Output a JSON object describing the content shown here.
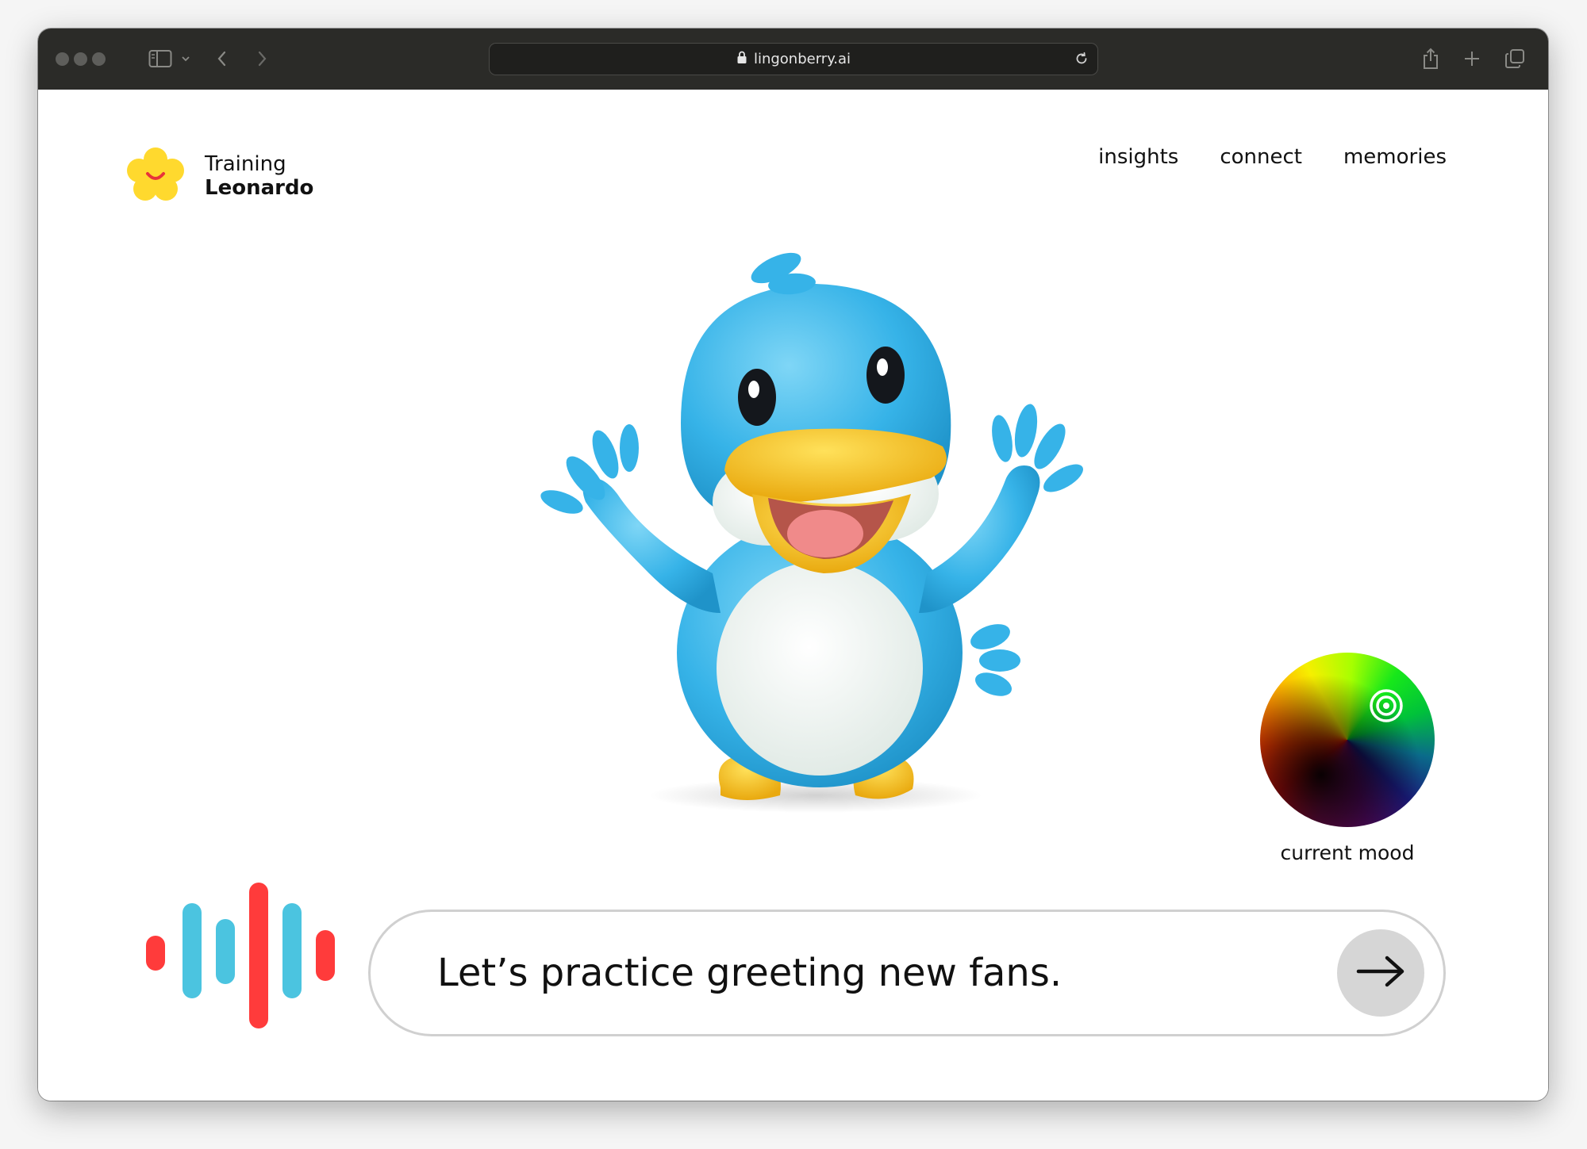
{
  "browser": {
    "url": "lingonberry.ai"
  },
  "brand": {
    "line1": "Training",
    "line2": "Leonardo"
  },
  "nav": {
    "items": [
      {
        "label": "insights"
      },
      {
        "label": "connect"
      },
      {
        "label": "memories"
      }
    ]
  },
  "mood": {
    "label": "current mood"
  },
  "prompt": {
    "text": "Let’s practice greeting new fans."
  },
  "colors": {
    "accent_red": "#ff3b3b",
    "accent_blue": "#4bc4e0",
    "logo_yellow": "#ffd92e",
    "mascot_blue": "#3cb6ea",
    "beak_yellow": "#f4c01e"
  }
}
